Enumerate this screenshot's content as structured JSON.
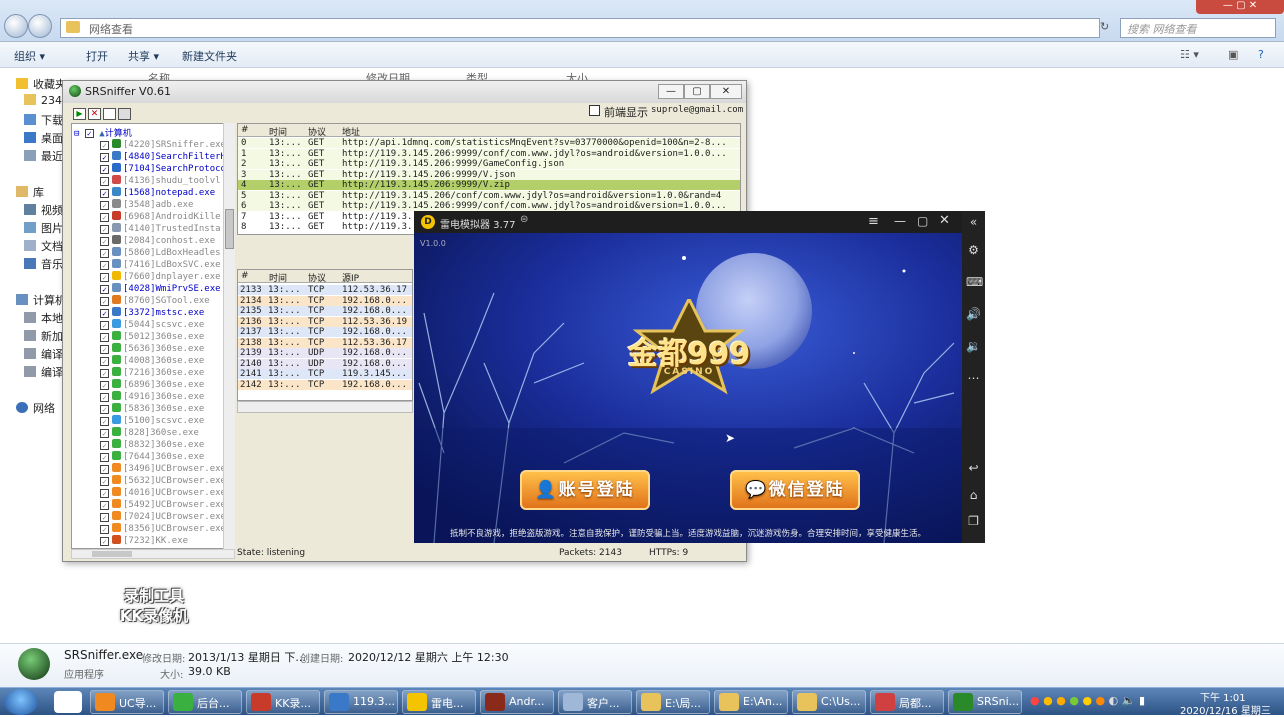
{
  "explorer": {
    "address": "网络查看",
    "search_placeholder": "搜索 网络查看",
    "toolbar": {
      "organize": "组织 ▾",
      "open": "打开",
      "share": "共享 ▾",
      "new_folder": "新建文件夹"
    },
    "columns": {
      "name": "名称",
      "modified": "修改日期",
      "type": "类型",
      "size": "大小"
    },
    "nav": [
      {
        "label": "收藏夹",
        "icon": "star-icon"
      },
      {
        "label": "2345",
        "icon": "folder-icon"
      },
      {
        "label": "下载",
        "icon": "download-folder-icon"
      },
      {
        "label": "桌面",
        "icon": "desktop-icon"
      },
      {
        "label": "最近",
        "icon": "recent-icon"
      },
      {
        "label": "库",
        "icon": "library-icon"
      },
      {
        "label": "视频",
        "icon": "video-icon"
      },
      {
        "label": "图片",
        "icon": "picture-icon"
      },
      {
        "label": "文档",
        "icon": "document-icon"
      },
      {
        "label": "音乐",
        "icon": "music-icon"
      },
      {
        "label": "计算机",
        "icon": "computer-icon"
      },
      {
        "label": "本地",
        "icon": "drive-icon"
      },
      {
        "label": "新加",
        "icon": "drive-icon"
      },
      {
        "label": "编译",
        "icon": "drive-icon"
      },
      {
        "label": "编译",
        "icon": "drive-icon"
      },
      {
        "label": "网络",
        "icon": "network-icon"
      }
    ],
    "details": {
      "filename": "SRSniffer.exe",
      "modified_label": "修改日期:",
      "modified": "2013/1/13 星期日 下...",
      "created_label": "创建日期:",
      "created": "2020/12/12 星期六 上午 12:30",
      "type": "应用程序",
      "size_label": "大小:",
      "size": "39.0 KB"
    }
  },
  "srsniffer": {
    "title": "SRSniffer V0.61",
    "frontmost_label": "前端显示",
    "email": "suprole@gmail.com",
    "tree_root": "计算机",
    "processes": [
      "[4220]SRSniffer.exe",
      "[4840]SearchFilterH",
      "[7104]SearchProtoco",
      "[4136]shudu_toolvl",
      "[1568]notepad.exe",
      "[3548]adb.exe",
      "[6968]AndroidKille",
      "[4140]TrustedInsta",
      "[2084]conhost.exe",
      "[5860]LdBoxHeadles",
      "[7416]LdBoxSVC.exe",
      "[7660]dnplayer.exe",
      "[4028]WmiPrvSE.exe",
      "[8760]SGTool.exe",
      "[3372]mstsc.exe",
      "[5044]scsvc.exe",
      "[5012]360se.exe",
      "[5636]360se.exe",
      "[4008]360se.exe",
      "[7216]360se.exe",
      "[6896]360se.exe",
      "[4916]360se.exe",
      "[5836]360se.exe",
      "[5100]scsvc.exe",
      "[828]360se.exe",
      "[8832]360se.exe",
      "[7644]360se.exe",
      "[3496]UCBrowser.exe",
      "[5632]UCBrowser.exe",
      "[4016]UCBrowser.exe",
      "[5492]UCBrowser.exe",
      "[7024]UCBrowser.exe",
      "[8356]UCBrowser.exe",
      "[7232]KK.exe"
    ],
    "http_headers": [
      "#",
      "时间",
      "协议",
      "地址"
    ],
    "http_rows": [
      [
        "0",
        "13:...",
        "GET",
        "http://api.1dmnq.com/statisticsMnqEvent?sv=03770000&openid=100&n=2-8..."
      ],
      [
        "1",
        "13:...",
        "GET",
        "http://119.3.145.206:9999/conf/com.www.jdyl?os=android&version=1.0.0..."
      ],
      [
        "2",
        "13:...",
        "GET",
        "http://119.3.145.206:9999/GameConfig.json"
      ],
      [
        "3",
        "13:...",
        "GET",
        "http://119.3.145.206:9999/V.json"
      ],
      [
        "4",
        "13:...",
        "GET",
        "http://119.3.145.206:9999/V.zip"
      ],
      [
        "5",
        "13:...",
        "GET",
        "http://119.3.145.206/conf/com.www.jdyl?os=android&version=1.0.0&rand=4"
      ],
      [
        "6",
        "13:...",
        "GET",
        "http://119.3.145.206:9999/conf/com.www.jdyl?os=android&version=1.0.0..."
      ],
      [
        "7",
        "13:...",
        "GET",
        "http://119.3..."
      ],
      [
        "8",
        "13:...",
        "GET",
        "http://119.3..."
      ]
    ],
    "raw_headers": [
      "#",
      "时间",
      "协议",
      "源IP"
    ],
    "raw_rows": [
      [
        "2133",
        "13:...",
        "TCP",
        "112.53.36.17"
      ],
      [
        "2134",
        "13:...",
        "TCP",
        "192.168.0..."
      ],
      [
        "2135",
        "13:...",
        "TCP",
        "192.168.0..."
      ],
      [
        "2136",
        "13:...",
        "TCP",
        "112.53.36.19"
      ],
      [
        "2137",
        "13:...",
        "TCP",
        "192.168.0..."
      ],
      [
        "2138",
        "13:...",
        "TCP",
        "112.53.36.17"
      ],
      [
        "2139",
        "13:...",
        "UDP",
        "192.168.0..."
      ],
      [
        "2140",
        "13:...",
        "UDP",
        "192.168.0..."
      ],
      [
        "2141",
        "13:...",
        "TCP",
        "119.3.145..."
      ],
      [
        "2142",
        "13:...",
        "TCP",
        "192.168.0..."
      ]
    ],
    "status": {
      "state": "State: listening",
      "packets": "Packets: 2143",
      "https": "HTTPs: 9"
    }
  },
  "emulator": {
    "title": "雷电模拟器 3.77",
    "version": "V1.0.0",
    "logo_text": "金都999",
    "logo_sub": "CASINO",
    "btn_account": "账号登陆",
    "btn_wechat": "微信登陆",
    "notice": "抵制不良游戏，拒绝盗版游戏。注意自我保护，谨防受骗上当。适度游戏益脑，沉迷游戏伤身。合理安排时间，享受健康生活。"
  },
  "watermark": {
    "line1": "录制工具",
    "line2": "KK录像机"
  },
  "taskbar": {
    "items": [
      "UC导...",
      "后台...",
      "KK录...",
      "119.3...",
      "雷电...",
      "Andr...",
      "客户...",
      "E:\\局...",
      "E:\\An...",
      "C:\\Us...",
      "局都...",
      "SRSni..."
    ],
    "time": "下午 1:01",
    "date": "2020/12/16 星期三"
  },
  "colors": {
    "accent_green": "#b2cf6a",
    "emu_bg": "#1b1b1b",
    "button_orange": "#e0731b"
  }
}
